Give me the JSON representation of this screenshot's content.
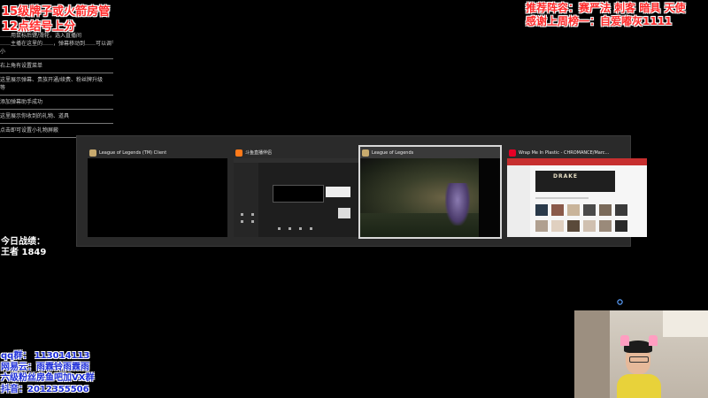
{
  "overlay_top_left": {
    "line1": "15级牌子或火箭房管",
    "line2": "12点结号上分",
    "chat_lines": [
      "……用鼠标后键/滑轮，选入直播间",
      "……主播在这里的……，弹幕移动到……可以调节弹幕位置大",
      "小",
      "右上角有设置菜单",
      "这里展示弹幕、贵族开通/续费、粉丝牌升级",
      "等",
      "添加弹幕助手成功",
      "这里展示你收到的礼物、道具",
      "点击即可设置小礼物屏蔽"
    ]
  },
  "overlay_top_right": {
    "line1": "推荐阵容：赛严法 刺客 暗具 天使",
    "line2": "感谢上周榜一：自爱嘟灰1111"
  },
  "record": {
    "label": "今日战绩：",
    "value": "王者 1849"
  },
  "overlay_bottom_left": {
    "qq": "qq群： 113014113",
    "netease": "网易云：雨霖铃雨霖雨",
    "fan_group": "六级粉丝房鱼吧加VX群",
    "douyin": "抖音：2012355506"
  },
  "task_switcher": {
    "windows": [
      {
        "title": "League of Legends (TM) Client",
        "icon": "lol-icon",
        "icon_color": "#c8aa6e",
        "selected": false
      },
      {
        "title": "斗鱼直播伴侣",
        "icon": "douyu-icon",
        "icon_color": "#ff7a1a",
        "selected": false
      },
      {
        "title": "League of Legends",
        "icon": "lol-icon",
        "icon_color": "#c8aa6e",
        "selected": true
      },
      {
        "title": "Wrap Me In Plastic - CHROMANCE/Marc...",
        "icon": "netease-music-icon",
        "icon_color": "#e60026",
        "selected": false
      }
    ],
    "music_banner_text": "DRAKE"
  },
  "colors": {
    "overlay_red": "#ff2a2a",
    "overlay_blue": "#1e2fd9",
    "switcher_bg": "#2a2a2a"
  }
}
